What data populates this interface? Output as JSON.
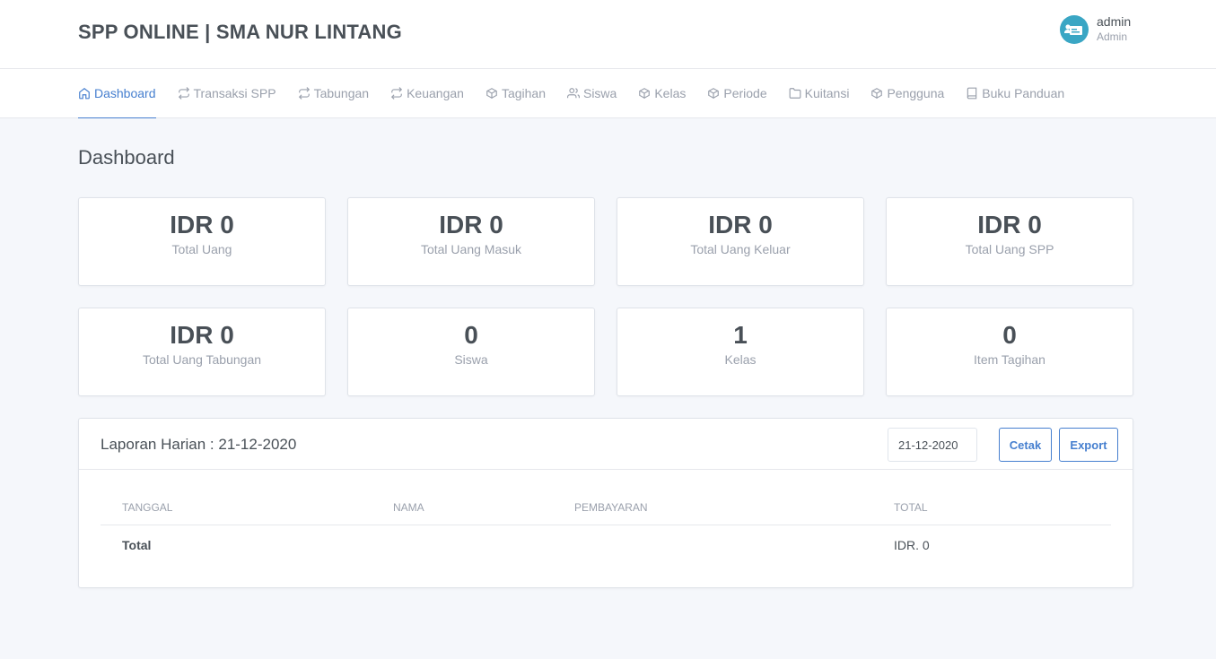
{
  "app": {
    "brand": "SPP ONLINE | SMA NUR LINTANG",
    "user_name": "admin",
    "user_role": "Admin",
    "accent_color": "#467fcf"
  },
  "nav": {
    "items": [
      {
        "label": "Dashboard",
        "icon": "home-icon"
      },
      {
        "label": "Transaksi SPP",
        "icon": "repeat-icon"
      },
      {
        "label": "Tabungan",
        "icon": "repeat-icon"
      },
      {
        "label": "Keuangan",
        "icon": "repeat-icon"
      },
      {
        "label": "Tagihan",
        "icon": "box-icon"
      },
      {
        "label": "Siswa",
        "icon": "users-icon"
      },
      {
        "label": "Kelas",
        "icon": "box-icon"
      },
      {
        "label": "Periode",
        "icon": "box-icon"
      },
      {
        "label": "Kuitansi",
        "icon": "folder-icon"
      },
      {
        "label": "Pengguna",
        "icon": "box-icon"
      },
      {
        "label": "Buku Panduan",
        "icon": "book-icon"
      }
    ],
    "active": "Dashboard"
  },
  "page": {
    "title": "Dashboard"
  },
  "stats": [
    {
      "value": "IDR 0",
      "label": "Total Uang"
    },
    {
      "value": "IDR 0",
      "label": "Total Uang Masuk"
    },
    {
      "value": "IDR 0",
      "label": "Total Uang Keluar"
    },
    {
      "value": "IDR 0",
      "label": "Total Uang SPP"
    },
    {
      "value": "IDR 0",
      "label": "Total Uang Tabungan"
    },
    {
      "value": "0",
      "label": "Siswa"
    },
    {
      "value": "1",
      "label": "Kelas"
    },
    {
      "value": "0",
      "label": "Item Tagihan"
    }
  ],
  "report": {
    "title": "Laporan Harian : 21-12-2020",
    "date_value": "21-12-2020",
    "print_label": "Cetak",
    "export_label": "Export",
    "columns": [
      "TANGGAL",
      "NAMA",
      "PEMBAYARAN",
      "TOTAL"
    ],
    "total_label": "Total",
    "total_value": "IDR. 0"
  }
}
